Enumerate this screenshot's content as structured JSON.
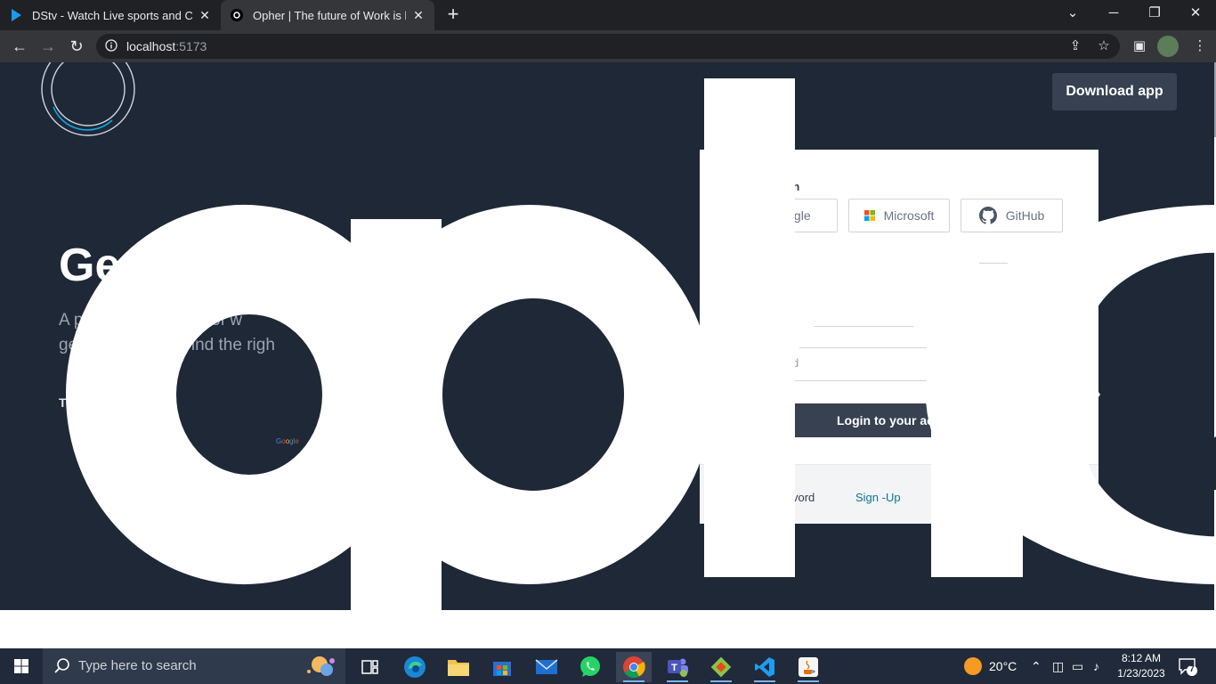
{
  "browser": {
    "tabs": [
      {
        "title": "DStv - Watch Live sports and Catch Up",
        "active": false,
        "close": "✕"
      },
      {
        "title": "Opher | The future of Work is here",
        "active": true,
        "close": "✕"
      }
    ],
    "new_tab": "+",
    "address": {
      "host": "localhost",
      "port": ":5173"
    }
  },
  "page": {
    "download_button": "Download app",
    "hero": {
      "title": "Ge",
      "subtitle_line1": "A p                  ature of w           your sk       he talking.",
      "subtitle_line2": "ge                  d. Find the righ          or you.",
      "trusted_label": "Tr",
      "google_logo_text": [
        "G",
        "o",
        "o",
        "g",
        "l",
        "e"
      ]
    },
    "brand_text": "opher",
    "login_card": {
      "signin_with": "th",
      "oauth_buttons": [
        {
          "label": "oogle",
          "icon": "google-icon"
        },
        {
          "label": "Microsoft",
          "icon": "microsoft-icon"
        },
        {
          "label": "GitHub",
          "icon": "github-icon"
        }
      ],
      "password_placeholder": "d",
      "login_button": "Login to your acc",
      "forgot_password": "vord",
      "signup_link": "Sign -Up"
    }
  },
  "taskbar": {
    "search_placeholder": "Type here to search",
    "weather": "20°C",
    "time": "8:12 AM",
    "date": "1/23/2023",
    "notifications": "7",
    "apps": [
      "task-view",
      "edge",
      "file-explorer",
      "microsoft-store",
      "mail",
      "whatsapp",
      "chrome",
      "teams",
      "git",
      "vscode",
      "java"
    ]
  },
  "colors": {
    "hero_bg": "#1e2836",
    "button_bg": "#374151",
    "link": "#0e7490",
    "taskbar_bg": "#202a3a"
  }
}
